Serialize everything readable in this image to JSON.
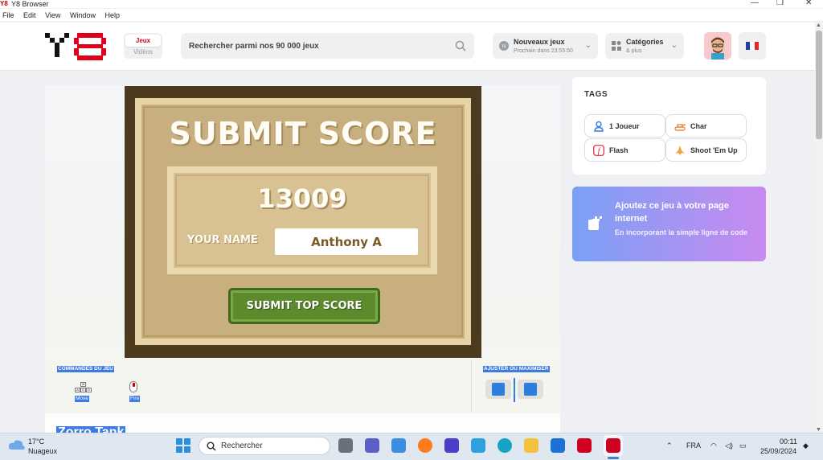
{
  "window": {
    "app_logo": "Y8",
    "title": "Y8 Browser"
  },
  "menu": [
    "File",
    "Edit",
    "View",
    "Window",
    "Help"
  ],
  "header": {
    "tabs": {
      "games": "Jeux",
      "videos": "Vidéos"
    },
    "search": {
      "placeholder": "Rechercher parmi nos 90 000 jeux"
    },
    "new_games": {
      "title": "Nouveaux jeux",
      "subtitle": "Prochain dans 23:55:50"
    },
    "categories": {
      "title": "Catégories",
      "subtitle": "& plus"
    },
    "language_flag": "fr-flag-icon"
  },
  "game": {
    "title_text": "SUBMIT SCORE",
    "score": "13009",
    "name_label": "YOUR NAME",
    "name_value": "Anthony A",
    "submit_label": "SUBMIT TOP SCORE",
    "controls_heading": "COMMANDES DU JEU",
    "controls": [
      {
        "icon": "wasd-keys-icon",
        "label": "Move"
      },
      {
        "icon": "mouse-icon",
        "label": "Fire"
      }
    ],
    "resize_heading": "AJUSTER OU MAXIMISER",
    "name": "Zorro Tank"
  },
  "sidebar": {
    "tags_title": "TAGS",
    "tags": [
      {
        "label": "1 Joueur",
        "icon": "user-icon"
      },
      {
        "label": "Char",
        "icon": "tank-icon"
      },
      {
        "label": "Flash",
        "icon": "flash-icon"
      },
      {
        "label": "Shoot 'Em Up",
        "icon": "rocket-icon"
      }
    ],
    "embed": {
      "title": "Ajoutez ce jeu à votre page internet",
      "subtitle": "En incorporant la simple ligne de code"
    }
  },
  "taskbar": {
    "weather_temp": "17°C",
    "weather_desc": "Nuageux",
    "search_label": "Rechercher",
    "language": "FRA",
    "time": "00:11",
    "date": "25/09/2024"
  }
}
